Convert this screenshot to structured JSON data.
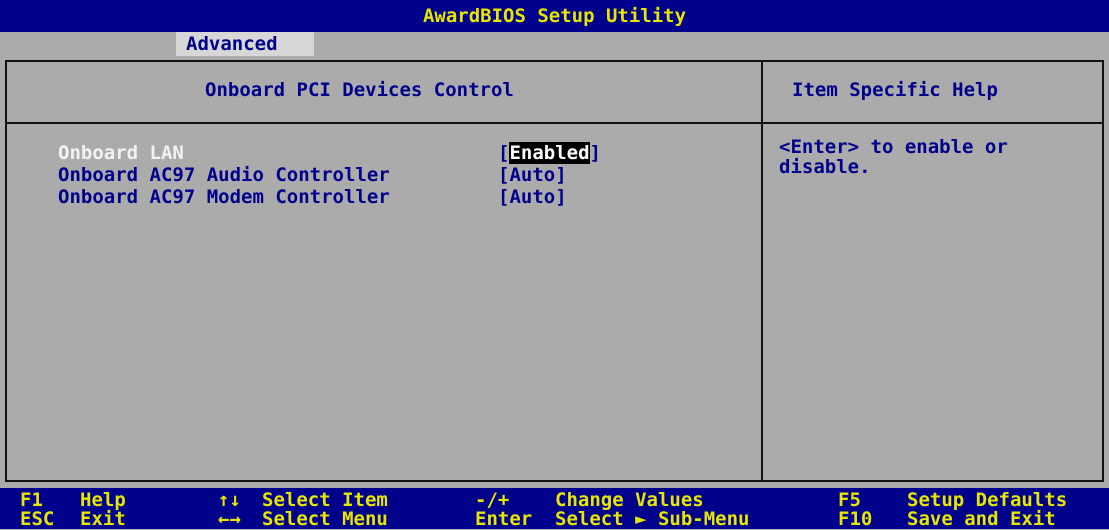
{
  "app_title": "AwardBIOS Setup Utility",
  "menu_tab": "Advanced",
  "panel_title": "Onboard PCI Devices Control",
  "help_title": "Item Specific Help",
  "settings": [
    {
      "label": "Onboard LAN",
      "open": "[",
      "value": "Enabled",
      "close": "]"
    },
    {
      "label": "Onboard AC97 Audio Controller",
      "value": "[Auto]"
    },
    {
      "label": "Onboard AC97 Modem Controller",
      "value": "[Auto]"
    }
  ],
  "help_text": "<Enter> to enable or disable.",
  "footer": {
    "keys": [
      {
        "key": "F1",
        "action": "Help"
      },
      {
        "key": "ESC",
        "action": "Exit"
      },
      {
        "key": "↑↓",
        "action": "Select Item"
      },
      {
        "key": "←→",
        "action": "Select Menu"
      },
      {
        "key": "-/+",
        "action": "Change Values"
      },
      {
        "key": "Enter",
        "action": "Select ► Sub-Menu"
      },
      {
        "key": "F5",
        "action": "Setup Defaults"
      },
      {
        "key": "F10",
        "action": "Save and Exit"
      }
    ]
  },
  "colors": {
    "background": "#ababab",
    "bar": "#00008b",
    "bar_text": "#e6e600",
    "item_text": "#00008b",
    "selected_text": "#f2f2f2"
  }
}
